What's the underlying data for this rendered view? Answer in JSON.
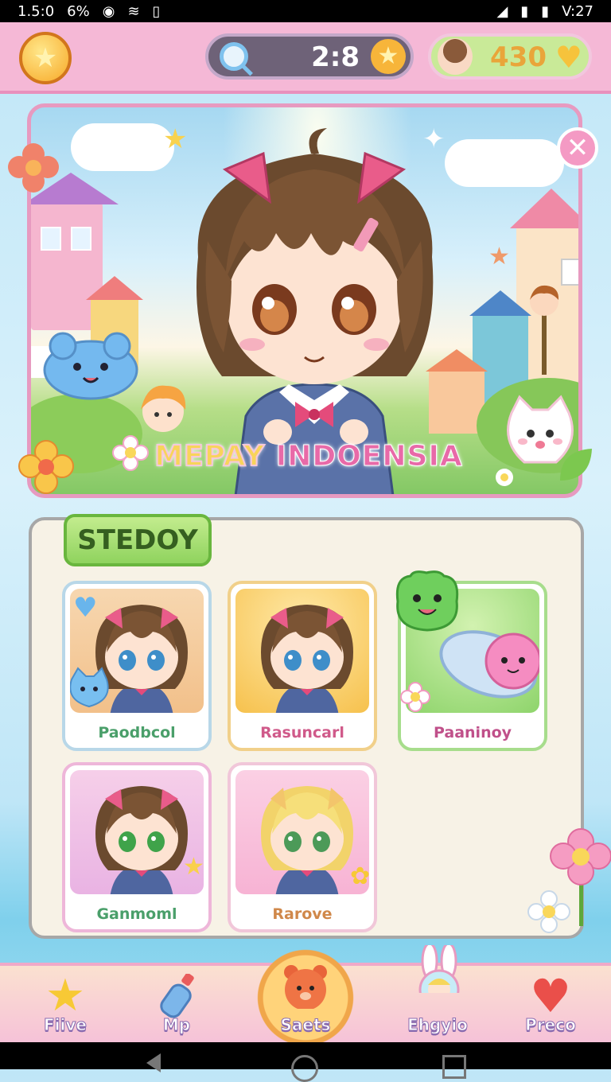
{
  "status_bar": {
    "time_left": "1.5:0",
    "battery_left": "6%",
    "time_right": "V:27"
  },
  "top_bar": {
    "timer_value": "2:8",
    "coin_value": "430",
    "star_button_icon": "star-icon",
    "search_icon": "search-icon",
    "coin_icon": "heart-icon"
  },
  "hero": {
    "title_part1": "MEPAY",
    "title_part2": "INDOENSIA",
    "close_icon": "close-icon"
  },
  "collection": {
    "label": "STEDOY",
    "cards": [
      {
        "name": "Paodbcol",
        "border": "#b8d7e8",
        "bg": "#f7d7b0"
      },
      {
        "name": "Rasuncarl",
        "border": "#f1d08a",
        "bg": "#f6c14d"
      },
      {
        "name": "Paaninoy",
        "border": "#a7dd8c",
        "bg": "#8ed46b"
      },
      {
        "name": "Ganmoml",
        "border": "#eeb6d9",
        "bg": "#f3c1e3"
      },
      {
        "name": "Rarove",
        "border": "#f1c7d9",
        "bg": "#f7b3d4"
      }
    ]
  },
  "bottom_nav": [
    {
      "label": "Fiive",
      "icon": "star-icon"
    },
    {
      "label": "Mp",
      "icon": "bottle-icon"
    },
    {
      "label": "Saets",
      "icon": "bear-icon"
    },
    {
      "label": "Ehgyio",
      "icon": "bunny-icon"
    },
    {
      "label": "Preco",
      "icon": "heart-icon"
    }
  ],
  "colors": {
    "accent_pink": "#f5b8d6",
    "accent_green": "#8fd35e",
    "coin_gold": "#f6c33c"
  }
}
